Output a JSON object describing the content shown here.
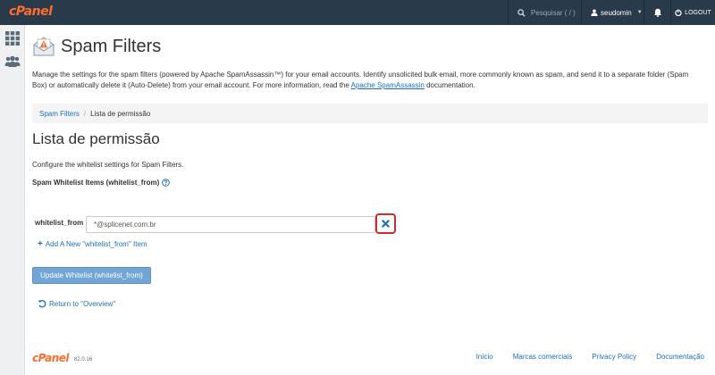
{
  "topbar": {
    "logo": "cPanel",
    "search_placeholder": "Pesquisar ( / )",
    "username": "seudomin",
    "logout_label": "LOGOUT"
  },
  "page": {
    "title": "Spam Filters",
    "description_before_link": "Manage the settings for the spam filters (powered by Apache SpamAssassin™) for your email accounts. Identify unsolicited bulk email, more commonly known as spam, and send it to a separate folder (Spam Box) or automatically delete it (Auto-Delete) from your email account. For more information, read the ",
    "description_link": "Apache SpamAssassin",
    "description_after_link": " documentation."
  },
  "breadcrumb": {
    "parent": "Spam Filters",
    "separator": "/",
    "current": "Lista de permissão"
  },
  "section": {
    "title": "Lista de permissão",
    "configure_text": "Configure the whitelist settings for Spam Filters.",
    "items_label": "Spam Whitelist Items (whitelist_from)",
    "row_label": "whitelist_from",
    "row_value": "*@splicenet.com.br",
    "add_item_label": "Add A New \"whitelist_from\" Item",
    "update_button": "Update Whitelist (whitelist_from)",
    "return_link": "Return to \"Overview\""
  },
  "footer": {
    "logo": "cPanel",
    "version": "82.0.16",
    "links": [
      "Início",
      "Marcas comerciais",
      "Privacy Policy",
      "Documentação"
    ]
  },
  "colors": {
    "topbar": "#293a4a",
    "brand": "#ff6c2c",
    "link": "#1d6fb8",
    "highlight": "#d9262c",
    "remove_icon": "#1d6fb8"
  },
  "icons": {
    "search": "search-icon",
    "user": "user-icon",
    "bell": "bell-icon",
    "logout": "logout-icon",
    "grid": "grid-icon",
    "users": "users-icon",
    "spam": "spam-filter-icon",
    "help": "question-circle-icon",
    "remove": "remove-x-icon",
    "return": "undo-icon"
  }
}
